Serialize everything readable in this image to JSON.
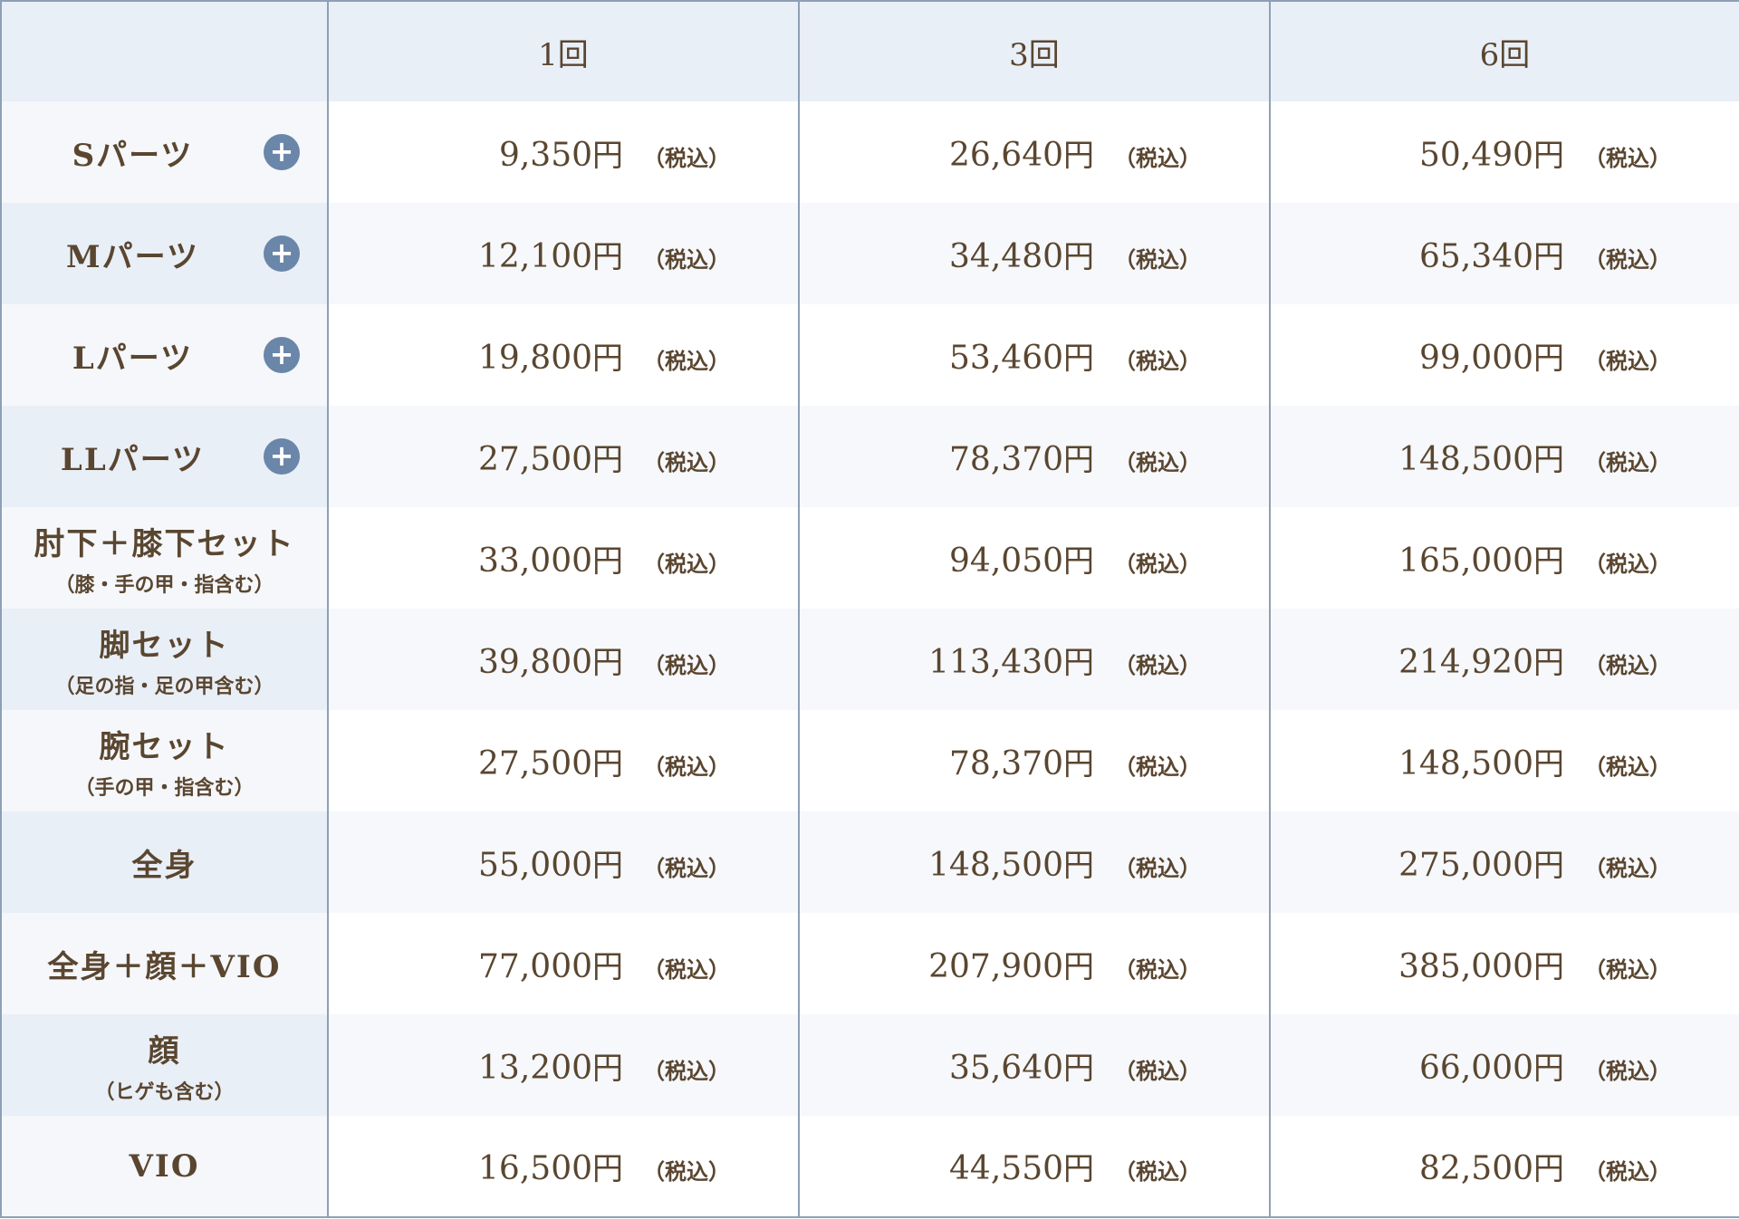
{
  "table": {
    "headers": [
      "",
      "1回",
      "3回",
      "6回"
    ],
    "yen_unit": "円",
    "tax_label": "（税込）",
    "rows": [
      {
        "label": "Sパーツ",
        "sub": "",
        "plus": true,
        "prices": [
          "9,350",
          "26,640",
          "50,490"
        ]
      },
      {
        "label": "Mパーツ",
        "sub": "",
        "plus": true,
        "prices": [
          "12,100",
          "34,480",
          "65,340"
        ]
      },
      {
        "label": "Lパーツ",
        "sub": "",
        "plus": true,
        "prices": [
          "19,800",
          "53,460",
          "99,000"
        ]
      },
      {
        "label": "LLパーツ",
        "sub": "",
        "plus": true,
        "prices": [
          "27,500",
          "78,370",
          "148,500"
        ]
      },
      {
        "label": "肘下＋膝下セット",
        "sub": "（膝・手の甲・指含む）",
        "plus": false,
        "prices": [
          "33,000",
          "94,050",
          "165,000"
        ]
      },
      {
        "label": "脚セット",
        "sub": "（足の指・足の甲含む）",
        "plus": false,
        "prices": [
          "39,800",
          "113,430",
          "214,920"
        ]
      },
      {
        "label": "腕セット",
        "sub": "（手の甲・指含む）",
        "plus": false,
        "prices": [
          "27,500",
          "78,370",
          "148,500"
        ]
      },
      {
        "label": "全身",
        "sub": "",
        "plus": false,
        "prices": [
          "55,000",
          "148,500",
          "275,000"
        ]
      },
      {
        "label": "全身＋顔＋VIO",
        "sub": "",
        "plus": false,
        "prices": [
          "77,000",
          "207,900",
          "385,000"
        ]
      },
      {
        "label": "顔",
        "sub": "（ヒゲも含む）",
        "plus": false,
        "prices": [
          "13,200",
          "35,640",
          "66,000"
        ]
      },
      {
        "label": "VIO",
        "sub": "",
        "plus": false,
        "prices": [
          "16,500",
          "44,550",
          "82,500"
        ]
      }
    ]
  },
  "colors": {
    "text": "#5a4630",
    "header_bg": "#e9eff7",
    "border": "#8ea0b5",
    "plus_icon": "#6a86a8"
  },
  "icons": {
    "plus": "plus-circle-icon"
  }
}
